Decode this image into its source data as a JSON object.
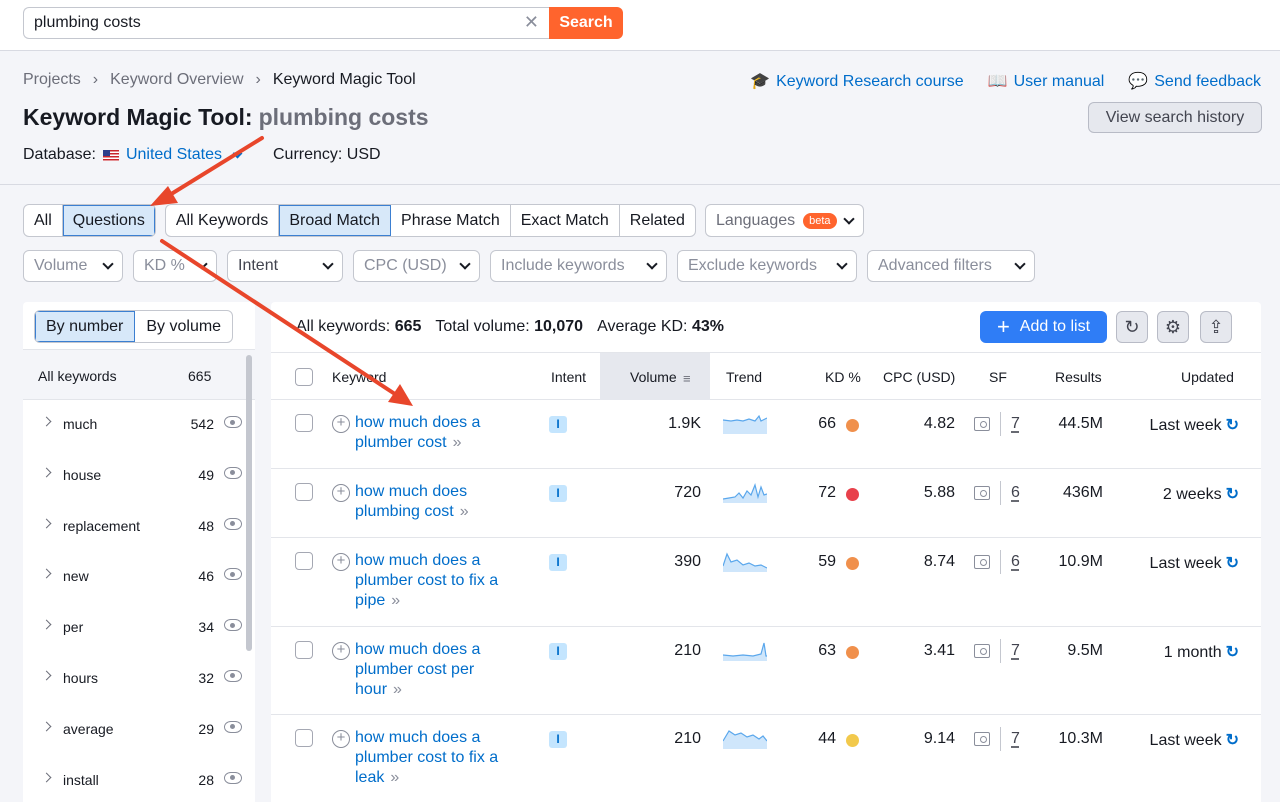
{
  "search": {
    "query": "plumbing costs",
    "clear": "✕",
    "button": "Search"
  },
  "breadcrumb": [
    "Projects",
    "Keyword Overview",
    "Keyword Magic Tool"
  ],
  "header_links": [
    {
      "icon": "graduation-cap-icon",
      "label": "Keyword Research course"
    },
    {
      "icon": "book-icon",
      "label": "User manual"
    },
    {
      "icon": "chat-bubble-icon",
      "label": "Send feedback"
    }
  ],
  "title": {
    "tool": "Keyword Magic Tool:",
    "query": "plumbing costs"
  },
  "history_button": "View search history",
  "database": {
    "label": "Database:",
    "value": "United States",
    "flag": "us-flag-icon"
  },
  "currency": "Currency: USD",
  "tabs_group1": [
    "All",
    "Questions"
  ],
  "tabs_group2": [
    "All Keywords",
    "Broad Match",
    "Phrase Match",
    "Exact Match",
    "Related"
  ],
  "languages": {
    "label": "Languages",
    "badge": "beta"
  },
  "filters": [
    "Volume",
    "KD %",
    "Intent",
    "CPC (USD)",
    "Include keywords",
    "Exclude keywords",
    "Advanced filters"
  ],
  "sidebar": {
    "toggle": [
      "By number",
      "By volume"
    ],
    "all": {
      "label": "All keywords",
      "count": "665"
    },
    "items": [
      {
        "label": "much",
        "count": "542"
      },
      {
        "label": "house",
        "count": "49"
      },
      {
        "label": "replacement",
        "count": "48"
      },
      {
        "label": "new",
        "count": "46"
      },
      {
        "label": "per",
        "count": "34"
      },
      {
        "label": "hours",
        "count": "32"
      },
      {
        "label": "average",
        "count": "29"
      },
      {
        "label": "install",
        "count": "28"
      }
    ]
  },
  "summary": {
    "all_label": "All keywords:",
    "all_value": "665",
    "vol_label": "Total volume:",
    "vol_value": "10,070",
    "kd_label": "Average KD:",
    "kd_value": "43%"
  },
  "add_button": "Add to list",
  "columns": [
    "Keyword",
    "Intent",
    "Volume",
    "Trend",
    "KD %",
    "CPC (USD)",
    "SF",
    "Results",
    "Updated"
  ],
  "rows": [
    {
      "keyword": "how much does a plumber cost",
      "intent": "I",
      "volume": "1.9K",
      "kd": "66",
      "kd_color": "#f0904c",
      "cpc": "4.82",
      "sf": "7",
      "results": "44.5M",
      "updated": "Last week"
    },
    {
      "keyword": "how much does plumbing cost",
      "intent": "I",
      "volume": "720",
      "kd": "72",
      "kd_color": "#e8414b",
      "cpc": "5.88",
      "sf": "6",
      "results": "436M",
      "updated": "2 weeks"
    },
    {
      "keyword": "how much does a plumber cost to fix a pipe",
      "intent": "I",
      "volume": "390",
      "kd": "59",
      "kd_color": "#f0904c",
      "cpc": "8.74",
      "sf": "6",
      "results": "10.9M",
      "updated": "Last week"
    },
    {
      "keyword": "how much does a plumber cost per hour",
      "intent": "I",
      "volume": "210",
      "kd": "63",
      "kd_color": "#f0904c",
      "cpc": "3.41",
      "sf": "7",
      "results": "9.5M",
      "updated": "1 month"
    },
    {
      "keyword": "how much does a plumber cost to fix a leak",
      "intent": "I",
      "volume": "210",
      "kd": "44",
      "kd_color": "#f2c94c",
      "cpc": "9.14",
      "sf": "7",
      "results": "10.3M",
      "updated": "Last week"
    }
  ],
  "colors": {
    "accent": "#ff642d",
    "link": "#006dca",
    "primary_button": "#2f7df6",
    "annotation_arrow": "#e8462b"
  }
}
